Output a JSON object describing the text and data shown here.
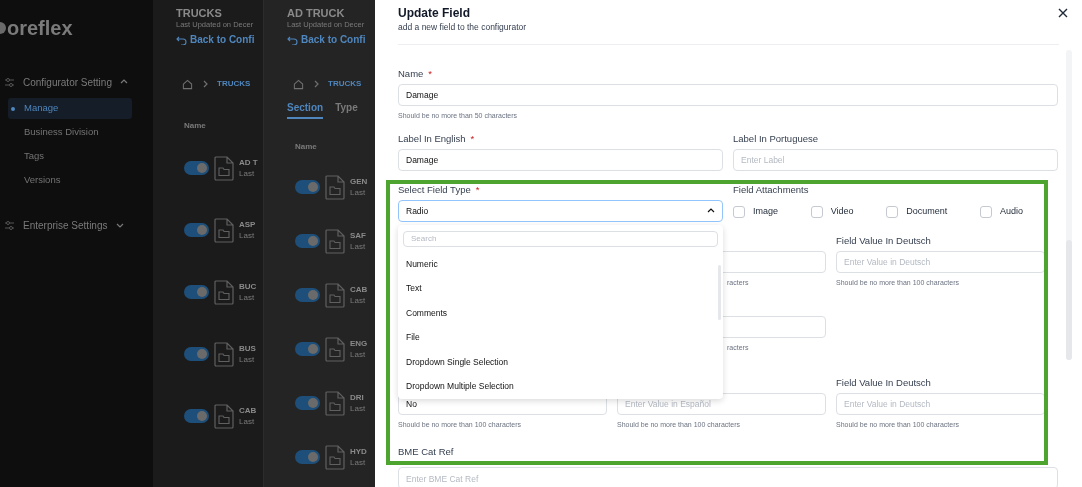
{
  "sidebar": {
    "logo": "oreflex",
    "groups": [
      {
        "label": "Configurator Setting",
        "expanded": true,
        "items": [
          {
            "label": "Manage",
            "selected": true
          },
          {
            "label": "Business Division",
            "selected": false
          },
          {
            "label": "Tags",
            "selected": false
          },
          {
            "label": "Versions",
            "selected": false
          }
        ]
      },
      {
        "label": "Enterprise Settings",
        "expanded": false
      }
    ]
  },
  "panels": [
    {
      "title": "TRUCKS",
      "subtitle": "Last Updated on Decer",
      "back_link": "Back to Confi",
      "breadcrumb": "TRUCKS",
      "column_header": "Name",
      "rows": [
        {
          "name": "AD T",
          "meta": "Last",
          "on": true
        },
        {
          "name": "ASP",
          "meta": "Last",
          "on": true
        },
        {
          "name": "BUC",
          "meta": "Last",
          "on": true
        },
        {
          "name": "BUS",
          "meta": "Last",
          "on": true
        },
        {
          "name": "CAB",
          "meta": "Last",
          "on": true
        }
      ]
    },
    {
      "title": "AD TRUCK",
      "subtitle": "Last Updated on Decer",
      "back_link": "Back to Confi",
      "breadcrumb": "TRUCKS",
      "tabs": [
        {
          "label": "Section",
          "selected": true
        },
        {
          "label": "Type",
          "selected": false
        }
      ],
      "column_header": "Name",
      "rows": [
        {
          "name": "GEN",
          "meta": "Last",
          "on": true
        },
        {
          "name": "SAF",
          "meta": "Last",
          "on": true
        },
        {
          "name": "CAB",
          "meta": "Last",
          "on": true
        },
        {
          "name": "ENG",
          "meta": "Last",
          "on": true
        },
        {
          "name": "DRI",
          "meta": "Last",
          "on": true
        },
        {
          "name": "HYD",
          "meta": "Last",
          "on": true
        }
      ]
    }
  ],
  "modal": {
    "title": "Update Field",
    "subtitle": "add a new field to the configurator",
    "name": {
      "label": "Name",
      "required_mark": "*",
      "value": "Damage",
      "hint": "Should be no more than 50 characters"
    },
    "labels": [
      {
        "label": "Label In English",
        "required_mark": "*",
        "value": "Damage"
      },
      {
        "label": "Label In Portuguese",
        "placeholder": "Enter Label"
      }
    ],
    "field_type": {
      "label": "Select Field Type",
      "required_mark": "*",
      "value": "Radio",
      "expanded": true,
      "search_placeholder": "Search",
      "options": [
        "Numeric",
        "Text",
        "Comments",
        "File",
        "Dropdown Single Selection",
        "Dropdown Multiple Selection"
      ]
    },
    "attachments": {
      "label": "Field Attachments",
      "options": [
        {
          "label": "Image",
          "checked": false
        },
        {
          "label": "Video",
          "checked": false
        },
        {
          "label": "Document",
          "checked": false
        },
        {
          "label": "Audio",
          "checked": false
        }
      ]
    },
    "value_rows": [
      {
        "cells": [
          {
            "kind": "hidden"
          },
          {
            "kind": "partial",
            "hint": "racters"
          },
          {
            "kind": "field",
            "label": "Field Value In Deutsch",
            "placeholder": "Enter Value in Deutsch",
            "hint": "Should be no more than 100 characters"
          }
        ]
      },
      {
        "cells": [
          {
            "kind": "hidden"
          },
          {
            "kind": "partial",
            "hint": "racters"
          }
        ]
      },
      {
        "cells": [
          {
            "kind": "field",
            "value": "No",
            "hint": "Should be no more than 100 characters"
          },
          {
            "kind": "field",
            "placeholder": "Enter Value in Español",
            "hint": "Should be no more than 100 characters"
          },
          {
            "kind": "field",
            "label": "Field Value In Deutsch",
            "placeholder": "Enter Value in Deutsch",
            "hint": "Should be no more than 100 characters"
          }
        ]
      }
    ],
    "bme": {
      "label": "BME Cat Ref",
      "placeholder": "Enter BME Cat Ref"
    },
    "highlight_frame": true
  }
}
